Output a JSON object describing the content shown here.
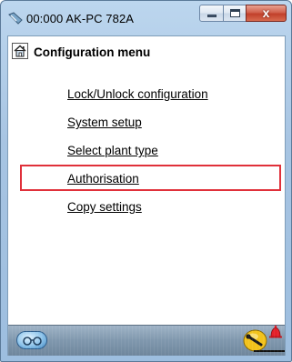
{
  "window": {
    "title": "00:000 AK-PC 782A",
    "close_symbol": "x",
    "icons": {
      "app": "plant-controller-icon",
      "minimize": "minimize-icon",
      "maximize": "maximize-icon",
      "close": "close-icon"
    }
  },
  "menu": {
    "title": "Configuration menu",
    "header_icon": "home-icon",
    "items": [
      {
        "label": "Lock/Unlock configuration"
      },
      {
        "label": "System setup"
      },
      {
        "label": "Select plant type"
      },
      {
        "label": "Authorisation",
        "highlighted": true
      },
      {
        "label": "Copy settings"
      }
    ]
  },
  "toolbar": {
    "icons": [
      "keys-icon",
      "wrench-icon",
      "alarm-bell-icon"
    ]
  },
  "colors": {
    "highlight_border": "#e0303a",
    "title_bar": "#a7c4e2",
    "close_button": "#c1402a",
    "toolbar": "#7f97ad",
    "alarm": "#e4202a"
  }
}
